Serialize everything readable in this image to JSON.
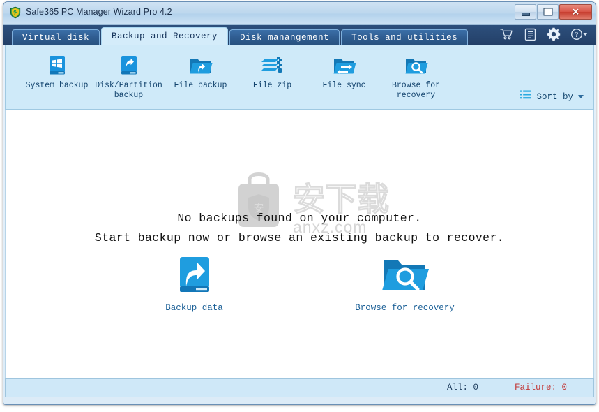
{
  "window": {
    "title": "Safe365 PC Manager Wizard Pro 4.2",
    "app_icon": "shield-icon",
    "controls": {
      "minimize": "minimize-button",
      "maximize": "maximize-button",
      "close_glyph": "✕"
    }
  },
  "tabs": [
    {
      "label": "Virtual disk",
      "active": false
    },
    {
      "label": "Backup and Recovery",
      "active": true
    },
    {
      "label": "Disk manangement",
      "active": false
    },
    {
      "label": "Tools and utilities",
      "active": false
    }
  ],
  "tab_tools": [
    {
      "name": "cart-icon"
    },
    {
      "name": "log-icon"
    },
    {
      "name": "gear-icon"
    },
    {
      "name": "help-icon"
    }
  ],
  "toolbar": {
    "items": [
      {
        "label": "System backup",
        "icon": "system-backup-icon"
      },
      {
        "label": "Disk/Partition backup",
        "icon": "disk-partition-backup-icon"
      },
      {
        "label": "File backup",
        "icon": "file-backup-icon"
      },
      {
        "label": "File zip",
        "icon": "file-zip-icon"
      },
      {
        "label": "File sync",
        "icon": "file-sync-icon"
      },
      {
        "label": "Browse for recovery",
        "icon": "browse-for-recovery-icon"
      }
    ],
    "sort_by_label": "Sort by",
    "sort_by_icon": "list-icon"
  },
  "content": {
    "message_line1": "No backups found on your computer.",
    "message_line2": "Start backup now or browse an existing backup to recover.",
    "actions": [
      {
        "label": "Backup data",
        "icon": "backup-data-icon"
      },
      {
        "label": "Browse for recovery",
        "icon": "browse-for-recovery-icon"
      }
    ],
    "watermark": {
      "text_cn": "安下载",
      "text_url": "anxz.com",
      "badge_char": "安"
    }
  },
  "statusbar": {
    "all_label": "All:",
    "all_value": "0",
    "failure_label": "Failure:",
    "failure_value": "0"
  },
  "colors": {
    "tabstrip": "#27466f",
    "toolbar_bg": "#cfeaf9",
    "accent_blue": "#1e9ae0",
    "failure_red": "#c23a3a"
  }
}
